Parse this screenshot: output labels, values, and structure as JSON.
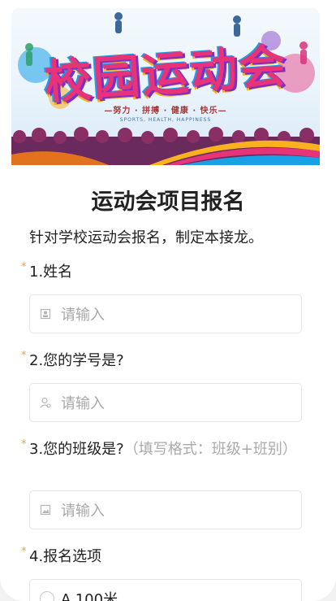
{
  "banner": {
    "title": "校园运动会",
    "slogan": "—努力 · 拼搏 · 健康 · 快乐—",
    "slogan_en": "SPORTS, HEALTH, HAPPINESS"
  },
  "form": {
    "title": "运动会项目报名",
    "description": "针对学校运动会报名，制定本接龙。",
    "required_mark": "*",
    "questions": [
      {
        "label": "1.姓名",
        "placeholder": "请输入",
        "icon": "person-icon"
      },
      {
        "label": "2.您的学号是?",
        "placeholder": "请输入",
        "icon": "user-id-icon"
      },
      {
        "label": "3.您的班级是?",
        "hint": "（填写格式：班级+班别）",
        "placeholder": "请输入",
        "icon": "image-icon"
      },
      {
        "label": "4.报名选项",
        "options": [
          "A.100米"
        ]
      }
    ]
  },
  "colors": {
    "required": "#f7a02a",
    "hint": "#aaaaaa",
    "placeholder": "#a8a8a8",
    "border": "#e6e6e6"
  }
}
